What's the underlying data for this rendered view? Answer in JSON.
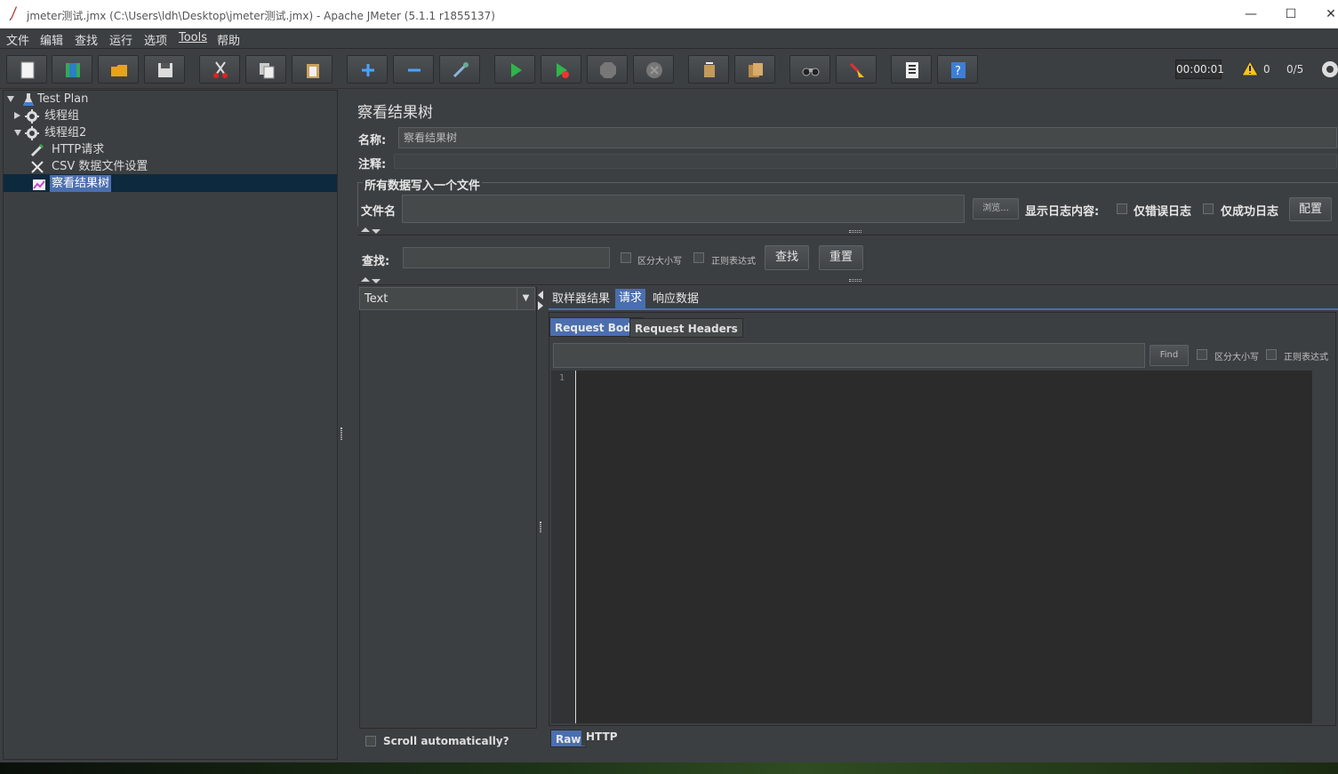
{
  "window": {
    "title": "jmeter测试.jmx (C:\\Users\\ldh\\Desktop\\jmeter测试.jmx) - Apache JMeter (5.1.1 r1855137)",
    "controls": {
      "minimize": "—",
      "maximize": "☐",
      "close": "✕"
    }
  },
  "menu": [
    "文件",
    "编辑",
    "查找",
    "运行",
    "选项",
    "Tools",
    "帮助"
  ],
  "toolbar": {
    "buttons": [
      "new-icon",
      "templates-icon",
      "open-icon",
      "save-icon",
      "cut-icon",
      "copy-icon",
      "paste-icon",
      "expand-icon",
      "collapse-icon",
      "toggle-icon",
      "start-icon",
      "start-no-pauses-icon",
      "stop-icon",
      "shutdown-icon",
      "clear-icon",
      "clear-all-icon",
      "search-icon",
      "reset-search-icon",
      "function-helper-icon",
      "help-icon"
    ],
    "timer": "00:00:01",
    "warning_count": "0",
    "active_threads": "0/5"
  },
  "tree": {
    "items": [
      {
        "label": "Test Plan",
        "icon": "test-plan-icon",
        "expanded": true
      },
      {
        "label": "线程组",
        "icon": "thread-group-icon",
        "expanded": false
      },
      {
        "label": "线程组2",
        "icon": "thread-group-icon",
        "expanded": true
      },
      {
        "label": "HTTP请求",
        "icon": "http-sampler-icon"
      },
      {
        "label": "CSV 数据文件设置",
        "icon": "csv-config-icon"
      },
      {
        "label": "察看结果树",
        "icon": "results-tree-icon",
        "selected": true
      }
    ]
  },
  "panel": {
    "title": "察看结果树",
    "name_label": "名称:",
    "name_value": "察看结果树",
    "comment_label": "注释:",
    "comment_value": "",
    "file_section": "所有数据写入一个文件",
    "filename_label": "文件名",
    "filename_value": "",
    "browse_button": "浏览...",
    "log_label": "显示日志内容:",
    "errors_only": "仅错误日志",
    "success_only": "仅成功日志",
    "configure_button": "配置",
    "search_label": "查找:",
    "search_value": "",
    "case_sensitive": "区分大小写",
    "regex": "正则表达式",
    "search_button": "查找",
    "reset_button": "重置",
    "renderer": "Text",
    "scroll_auto": "Scroll automatically?",
    "tabs": [
      "取样器结果",
      "请求",
      "响应数据"
    ],
    "active_tab": "请求",
    "sub_tabs": [
      "Request Body",
      "Request Headers"
    ],
    "find_value": "",
    "find_button": "Find",
    "find_case": "区分大小写",
    "find_regex": "正则表达式",
    "line_number": "1",
    "bottom_tabs": [
      "Raw",
      "HTTP"
    ]
  },
  "colors": {
    "background": "#3c3f41",
    "selection": "#4b6eaf",
    "tree_selection": "#0d293e"
  }
}
